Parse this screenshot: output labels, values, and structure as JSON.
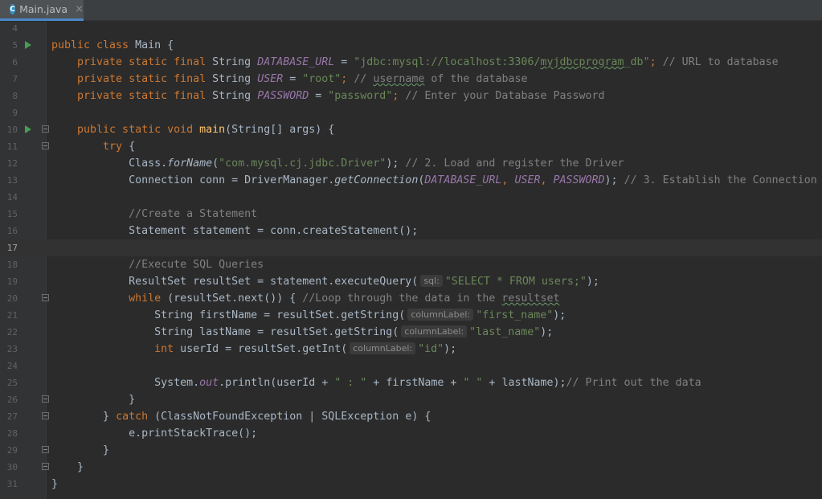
{
  "tab": {
    "icon": "C",
    "name": "Main.java",
    "close": "×"
  },
  "lines": [
    {
      "n": "4",
      "current": false,
      "run": false,
      "fold": false,
      "segs": []
    },
    {
      "n": "5",
      "current": false,
      "run": true,
      "fold": false,
      "segs": [
        {
          "t": "public class ",
          "c": "kw"
        },
        {
          "t": "Main {",
          "c": ""
        }
      ]
    },
    {
      "n": "6",
      "current": false,
      "run": false,
      "fold": false,
      "segs": [
        {
          "t": "    private static final ",
          "c": "kw"
        },
        {
          "t": "String ",
          "c": ""
        },
        {
          "t": "DATABASE_URL",
          "c": "field"
        },
        {
          "t": " = ",
          "c": ""
        },
        {
          "t": "\"jdbc:mysql://localhost:3306/",
          "c": "str"
        },
        {
          "t": "myjdbcprogram",
          "c": "str squig"
        },
        {
          "t": "_db\"",
          "c": "str"
        },
        {
          "t": "; ",
          "c": "kw"
        },
        {
          "t": "// URL to database",
          "c": "cmt"
        }
      ]
    },
    {
      "n": "7",
      "current": false,
      "run": false,
      "fold": false,
      "segs": [
        {
          "t": "    private static final ",
          "c": "kw"
        },
        {
          "t": "String ",
          "c": ""
        },
        {
          "t": "USER",
          "c": "field"
        },
        {
          "t": " = ",
          "c": ""
        },
        {
          "t": "\"root\"",
          "c": "str"
        },
        {
          "t": "; ",
          "c": "kw"
        },
        {
          "t": "// ",
          "c": "cmt"
        },
        {
          "t": "username",
          "c": "cmt squig"
        },
        {
          "t": " of the database",
          "c": "cmt"
        }
      ]
    },
    {
      "n": "8",
      "current": false,
      "run": false,
      "fold": false,
      "segs": [
        {
          "t": "    private static final ",
          "c": "kw"
        },
        {
          "t": "String ",
          "c": ""
        },
        {
          "t": "PASSWORD",
          "c": "field"
        },
        {
          "t": " = ",
          "c": ""
        },
        {
          "t": "\"password\"",
          "c": "str"
        },
        {
          "t": "; ",
          "c": "kw"
        },
        {
          "t": "// Enter your Database Password",
          "c": "cmt"
        }
      ]
    },
    {
      "n": "9",
      "current": false,
      "run": false,
      "fold": false,
      "segs": []
    },
    {
      "n": "10",
      "current": false,
      "run": true,
      "fold": true,
      "segs": [
        {
          "t": "    public static void ",
          "c": "kw"
        },
        {
          "t": "main",
          "c": "fn"
        },
        {
          "t": "(String[] args) {",
          "c": ""
        }
      ]
    },
    {
      "n": "11",
      "current": false,
      "run": false,
      "fold": true,
      "segs": [
        {
          "t": "        try ",
          "c": "kw"
        },
        {
          "t": "{",
          "c": ""
        }
      ]
    },
    {
      "n": "12",
      "current": false,
      "run": false,
      "fold": false,
      "segs": [
        {
          "t": "            Class.",
          "c": ""
        },
        {
          "t": "forName",
          "c": "it"
        },
        {
          "t": "(",
          "c": ""
        },
        {
          "t": "\"com.mysql.cj.jdbc.Driver\"",
          "c": "str"
        },
        {
          "t": "); ",
          "c": ""
        },
        {
          "t": "// 2. Load and register the Driver",
          "c": "cmt"
        }
      ]
    },
    {
      "n": "13",
      "current": false,
      "run": false,
      "fold": false,
      "segs": [
        {
          "t": "            Connection conn = DriverManager.",
          "c": ""
        },
        {
          "t": "getConnection",
          "c": "it"
        },
        {
          "t": "(",
          "c": ""
        },
        {
          "t": "DATABASE_URL",
          "c": "field"
        },
        {
          "t": ", ",
          "c": "kw"
        },
        {
          "t": "USER",
          "c": "field"
        },
        {
          "t": ", ",
          "c": "kw"
        },
        {
          "t": "PASSWORD",
          "c": "field"
        },
        {
          "t": "); ",
          "c": ""
        },
        {
          "t": "// 3. Establish the Connection",
          "c": "cmt"
        }
      ]
    },
    {
      "n": "14",
      "current": false,
      "run": false,
      "fold": false,
      "segs": []
    },
    {
      "n": "15",
      "current": false,
      "run": false,
      "fold": false,
      "segs": [
        {
          "t": "            //Create a Statement",
          "c": "cmt"
        }
      ]
    },
    {
      "n": "16",
      "current": false,
      "run": false,
      "fold": false,
      "segs": [
        {
          "t": "            Statement statement = conn.createStatement();",
          "c": ""
        }
      ]
    },
    {
      "n": "17",
      "current": true,
      "run": false,
      "fold": false,
      "segs": []
    },
    {
      "n": "18",
      "current": false,
      "run": false,
      "fold": false,
      "segs": [
        {
          "t": "            //Execute SQL Queries",
          "c": "cmt"
        }
      ]
    },
    {
      "n": "19",
      "current": false,
      "run": false,
      "fold": false,
      "segs": [
        {
          "t": "            ResultSet resultSet = statement.executeQuery(",
          "c": ""
        },
        {
          "hint": "sql:"
        },
        {
          "t": "\"SELECT * FROM users;\"",
          "c": "str"
        },
        {
          "t": ");",
          "c": ""
        }
      ]
    },
    {
      "n": "20",
      "current": false,
      "run": false,
      "fold": true,
      "segs": [
        {
          "t": "            while ",
          "c": "kw"
        },
        {
          "t": "(resultSet.next()) { ",
          "c": ""
        },
        {
          "t": "//Loop through the data in the ",
          "c": "cmt"
        },
        {
          "t": "resultset",
          "c": "cmt squig"
        }
      ]
    },
    {
      "n": "21",
      "current": false,
      "run": false,
      "fold": false,
      "segs": [
        {
          "t": "                String firstName = resultSet.getString(",
          "c": ""
        },
        {
          "hint": "columnLabel:"
        },
        {
          "t": "\"first_name\"",
          "c": "str"
        },
        {
          "t": ");",
          "c": ""
        }
      ]
    },
    {
      "n": "22",
      "current": false,
      "run": false,
      "fold": false,
      "segs": [
        {
          "t": "                String lastName = resultSet.getString(",
          "c": ""
        },
        {
          "hint": "columnLabel:"
        },
        {
          "t": "\"last_name\"",
          "c": "str"
        },
        {
          "t": ");",
          "c": ""
        }
      ]
    },
    {
      "n": "23",
      "current": false,
      "run": false,
      "fold": false,
      "segs": [
        {
          "t": "                int ",
          "c": "kw"
        },
        {
          "t": "userId = resultSet.getInt(",
          "c": ""
        },
        {
          "hint": "columnLabel:"
        },
        {
          "t": "\"id\"",
          "c": "str"
        },
        {
          "t": ");",
          "c": ""
        }
      ]
    },
    {
      "n": "24",
      "current": false,
      "run": false,
      "fold": false,
      "segs": []
    },
    {
      "n": "25",
      "current": false,
      "run": false,
      "fold": false,
      "segs": [
        {
          "t": "                System.",
          "c": ""
        },
        {
          "t": "out",
          "c": "field"
        },
        {
          "t": ".println(userId + ",
          "c": ""
        },
        {
          "t": "\" : \"",
          "c": "str"
        },
        {
          "t": " + firstName + ",
          "c": ""
        },
        {
          "t": "\" \"",
          "c": "str"
        },
        {
          "t": " + lastName);",
          "c": ""
        },
        {
          "t": "// Print out the data",
          "c": "cmt"
        }
      ]
    },
    {
      "n": "26",
      "current": false,
      "run": false,
      "fold": true,
      "segs": [
        {
          "t": "            }",
          "c": ""
        }
      ]
    },
    {
      "n": "27",
      "current": false,
      "run": false,
      "fold": true,
      "segs": [
        {
          "t": "        } ",
          "c": ""
        },
        {
          "t": "catch ",
          "c": "kw"
        },
        {
          "t": "(ClassNotFoundException | SQLException e) {",
          "c": ""
        }
      ]
    },
    {
      "n": "28",
      "current": false,
      "run": false,
      "fold": false,
      "segs": [
        {
          "t": "            e.printStackTrace();",
          "c": ""
        }
      ]
    },
    {
      "n": "29",
      "current": false,
      "run": false,
      "fold": true,
      "segs": [
        {
          "t": "        }",
          "c": ""
        }
      ]
    },
    {
      "n": "30",
      "current": false,
      "run": false,
      "fold": true,
      "segs": [
        {
          "t": "    }",
          "c": ""
        }
      ]
    },
    {
      "n": "31",
      "current": false,
      "run": false,
      "fold": false,
      "segs": [
        {
          "t": "}",
          "c": ""
        }
      ]
    }
  ]
}
